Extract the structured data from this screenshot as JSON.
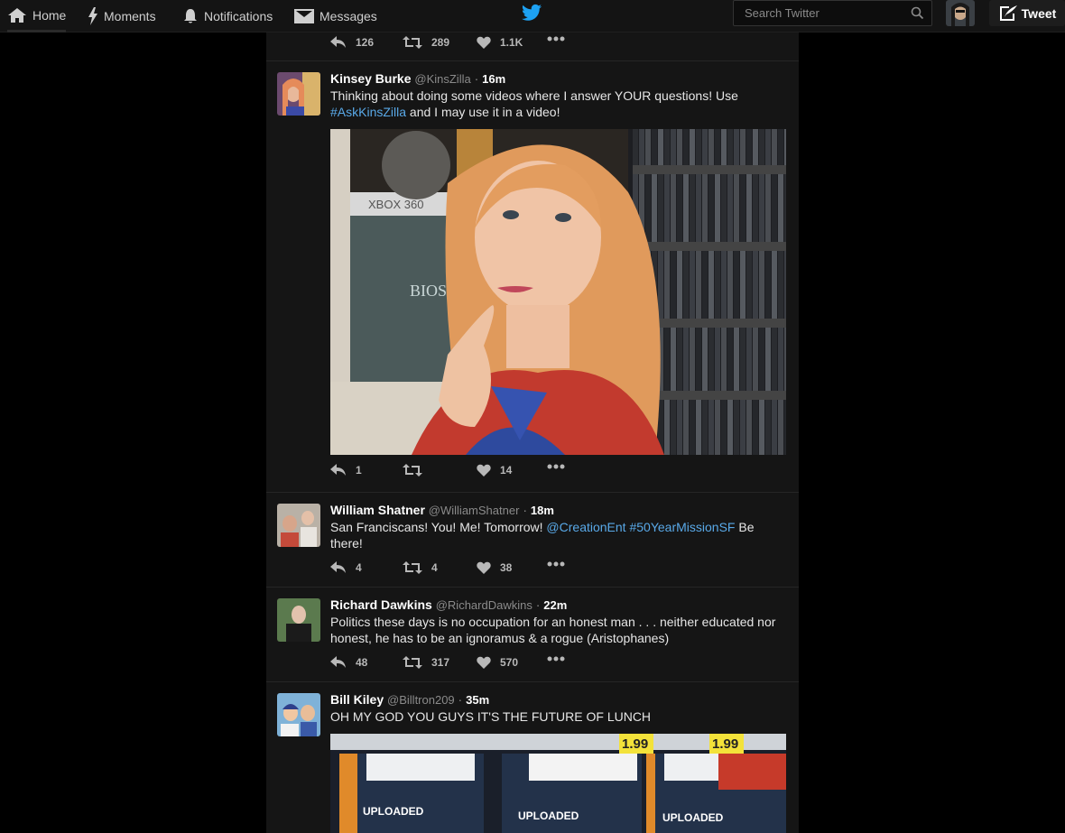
{
  "nav": {
    "home": "Home",
    "moments": "Moments",
    "notifications": "Notifications",
    "messages": "Messages",
    "search_placeholder": "Search Twitter",
    "tweet_button": "Tweet"
  },
  "colors": {
    "link": "#59a9e8",
    "brand": "#1da1f2"
  },
  "top_tweet": {
    "replies": "126",
    "retweets": "289",
    "likes": "1.1K"
  },
  "tweets": [
    {
      "fullname": "Kinsey Burke",
      "handle": "@KinsZilla",
      "time": "16m",
      "text_1": "Thinking about doing some videos where I answer YOUR questions! Use",
      "hashtag": "#AskKinsZilla",
      "text_2": " and I may use it in a video!",
      "replies": "1",
      "retweets": "",
      "likes": "14"
    },
    {
      "fullname": "William Shatner",
      "handle": "@WilliamShatner",
      "time": "18m",
      "text_1": "San Franciscans! You! Me! Tomorrow! ",
      "mention": "@CreationEnt",
      "hashtag": "#50YearMissionSF",
      "text_2": " Be there!",
      "replies": "4",
      "retweets": "4",
      "likes": "38"
    },
    {
      "fullname": "Richard Dawkins",
      "handle": "@RichardDawkins",
      "time": "22m",
      "text": "Politics these days is no occupation for an honest man . . . neither educated nor honest, he has to be an ignoramus & a rogue (Aristophanes)",
      "replies": "48",
      "retweets": "317",
      "likes": "570"
    },
    {
      "fullname": "Bill Kiley",
      "handle": "@Billtron209",
      "time": "35m",
      "text": "OH MY GOD YOU GUYS IT'S THE FUTURE OF LUNCH",
      "media_labels": [
        "UPLOADED",
        "UPLOADED",
        "UPLOADED"
      ],
      "prices": [
        "1.99",
        "1.99"
      ]
    }
  ]
}
